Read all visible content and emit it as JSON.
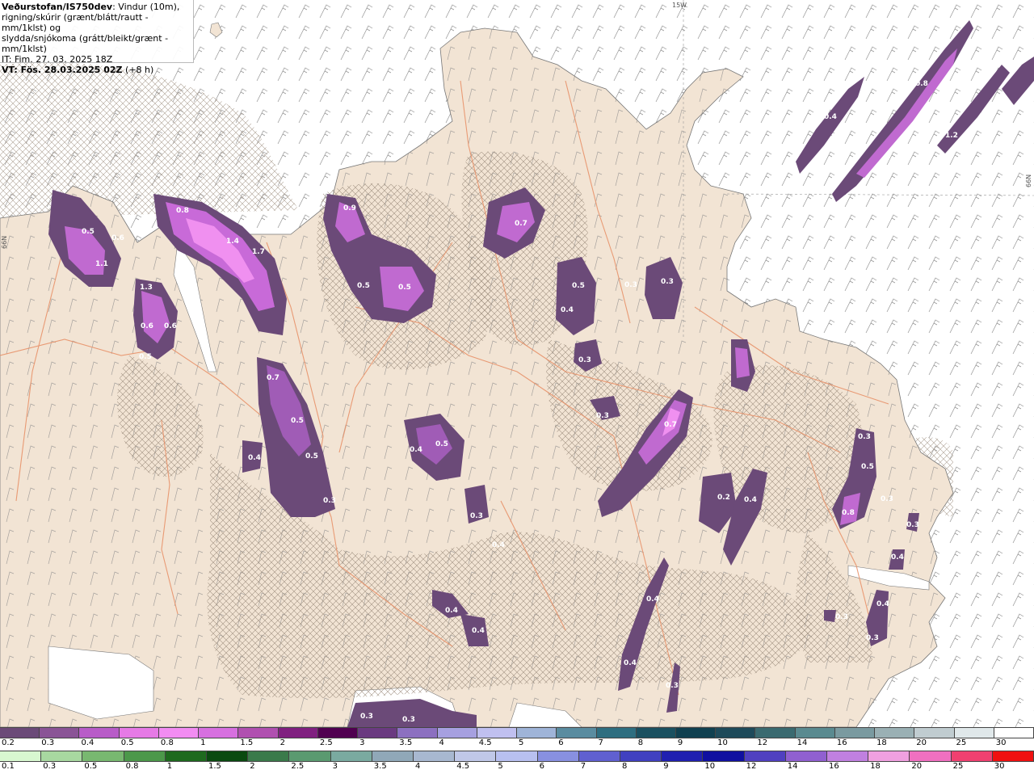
{
  "header": {
    "title": "Veðurstofan/IS750dev",
    "line1_suffix": ": Vindur (10m),",
    "line2": "rigning/skúrir (grænt/blátt/rautt - mm/1klst) og",
    "line3": "slydda/snjókoma (grátt/bleikt/grænt - mm/1klst)",
    "it": "IT: Fim. 27. 03. 2025 18Z",
    "vt_label": "VT: Fös. 28.03.2025 02Z",
    "vt_suffix": " (+8 h)"
  },
  "map": {
    "meridian_label": "15W",
    "lat_label_right": "66N",
    "lat_label_left": "66N",
    "colors": {
      "sea": "#ffffff",
      "land": "#f2e4d4",
      "roads": "#e8926a",
      "precip_light": "#6b4a78",
      "precip_mid": "#a05cb6",
      "precip_high": "#d770e0",
      "precip_max": "#f28cf2"
    },
    "value_labels": [
      {
        "text": "0.5"
      },
      {
        "text": "0.6"
      },
      {
        "text": "1.1"
      },
      {
        "text": "0.8"
      },
      {
        "text": "1.4"
      },
      {
        "text": "1.7"
      },
      {
        "text": "1.3"
      },
      {
        "text": "0.6"
      },
      {
        "text": "0.6"
      },
      {
        "text": "0.5"
      },
      {
        "text": "0.9"
      },
      {
        "text": "0.5"
      },
      {
        "text": "0.5"
      },
      {
        "text": "0.7"
      },
      {
        "text": "0.5"
      },
      {
        "text": "0.3"
      },
      {
        "text": "0.3"
      },
      {
        "text": "0.4"
      },
      {
        "text": "0.3"
      },
      {
        "text": "0.3"
      },
      {
        "text": "0.7"
      },
      {
        "text": "0.5"
      },
      {
        "text": "0.5"
      },
      {
        "text": "0.4"
      },
      {
        "text": "0.4"
      },
      {
        "text": "0.5"
      },
      {
        "text": "0.3"
      },
      {
        "text": "0.3"
      },
      {
        "text": "0.4"
      },
      {
        "text": "0.7"
      },
      {
        "text": "0.2"
      },
      {
        "text": "0.4"
      },
      {
        "text": "0.4"
      },
      {
        "text": "0.4"
      },
      {
        "text": "0.4"
      },
      {
        "text": "0.4"
      },
      {
        "text": "0.3"
      },
      {
        "text": "0.3"
      },
      {
        "text": "0.3"
      },
      {
        "text": "0.5"
      },
      {
        "text": "0.8"
      },
      {
        "text": "0.3"
      },
      {
        "text": "0.4"
      },
      {
        "text": "0.4"
      },
      {
        "text": "0.3"
      },
      {
        "text": "0.3"
      },
      {
        "text": "0.4"
      },
      {
        "text": "0.8"
      },
      {
        "text": "1.2"
      },
      {
        "text": "0.3"
      },
      {
        "text": "0.3"
      }
    ]
  },
  "legend_snow": {
    "labels": [
      "0.2",
      "0.3",
      "0.4",
      "0.5",
      "0.8",
      "1",
      "1.5",
      "2",
      "2.5",
      "3",
      "3.5",
      "4",
      "4.5",
      "5",
      "6",
      "7",
      "8",
      "9",
      "10",
      "12",
      "14",
      "16",
      "18",
      "20",
      "25",
      "30"
    ],
    "colors": [
      "#6b4a78",
      "#8a5496",
      "#b85cc8",
      "#e67ae6",
      "#f28cf2",
      "#d770e0",
      "#b050b0",
      "#802080",
      "#500050",
      "#6a3a80",
      "#8c70c0",
      "#a6a0e0",
      "#c0c0f0",
      "#9fb4d8",
      "#5a8ca0",
      "#2e6e80",
      "#1a5060",
      "#104050",
      "#1e4a5a",
      "#3a6a70",
      "#5a8a90",
      "#7a9aa0",
      "#9ab0b4",
      "#c0ccd0",
      "#e0e8ea",
      "#ffffff"
    ]
  },
  "legend_rain": {
    "labels": [
      "0.1",
      "0.3",
      "0.5",
      "0.8",
      "1",
      "1.5",
      "2",
      "2.5",
      "3",
      "3.5",
      "4",
      "4.5",
      "5",
      "6",
      "7",
      "8",
      "9",
      "10",
      "12",
      "14",
      "16",
      "18",
      "20",
      "25",
      "30"
    ],
    "colors": [
      "#d8f8d0",
      "#a8d8a0",
      "#78b870",
      "#4c984a",
      "#1e6a1e",
      "#0a4a10",
      "#3a7a4a",
      "#5a9a70",
      "#7aaaa0",
      "#90a8b8",
      "#a8b8d0",
      "#c0c8e8",
      "#b8c0f0",
      "#8890e0",
      "#6060d0",
      "#4040c0",
      "#2020b0",
      "#1010a0",
      "#5040c0",
      "#9060d0",
      "#c080e0",
      "#f0a0e0",
      "#f070c0",
      "#f04070",
      "#f01010"
    ]
  }
}
